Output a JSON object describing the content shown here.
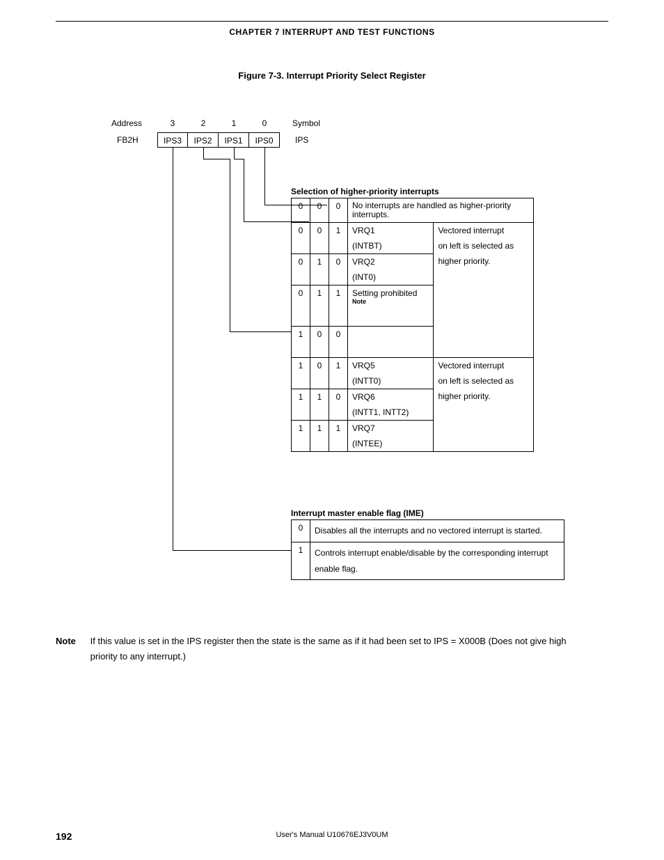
{
  "header": {
    "chapter": "CHAPTER 7   INTERRUPT AND TEST FUNCTIONS"
  },
  "figure": {
    "title": "Figure 7-3.  Interrupt Priority Select Register"
  },
  "register": {
    "address_label": "Address",
    "symbol_label": "Symbol",
    "address_value": "FB2H",
    "symbol_value": "IPS",
    "bit_numbers": [
      "3",
      "2",
      "1",
      "0"
    ],
    "bit_names": [
      "IPS3",
      "IPS2",
      "IPS1",
      "IPS0"
    ]
  },
  "table1": {
    "title": "Selection of higher-priority interrupts",
    "rows": [
      {
        "b": [
          "0",
          "0",
          "0"
        ],
        "desc1": "No interrupts are handled as higher-priority interrupts.",
        "desc2": "",
        "vec": ""
      },
      {
        "b": [
          "0",
          "0",
          "1"
        ],
        "desc1": "VRQ1",
        "desc2": "(INTBT)",
        "vec": "Vectored interrupt"
      },
      {
        "b": [
          "0",
          "1",
          "0"
        ],
        "desc1": "VRQ2",
        "desc2": "(INT0)",
        "vec": "on left is selected as"
      },
      {
        "b": [
          "0",
          "1",
          "1"
        ],
        "desc1": "Setting prohibited",
        "desc2": "",
        "vec": "higher priority.",
        "noteSup": "Note"
      },
      {
        "b": [
          "1",
          "0",
          "0"
        ],
        "desc1": "",
        "desc2": "",
        "vec": ""
      },
      {
        "b": [
          "1",
          "0",
          "1"
        ],
        "desc1": "VRQ5",
        "desc2": "(INTT0)",
        "vec": "Vectored interrupt"
      },
      {
        "b": [
          "1",
          "1",
          "0"
        ],
        "desc1": "VRQ6",
        "desc2": "(INTT1, INTT2)",
        "vec": "on left is selected as"
      },
      {
        "b": [
          "1",
          "1",
          "1"
        ],
        "desc1": "VRQ7",
        "desc2": "(INTEE)",
        "vec": "higher priority."
      }
    ],
    "vec_group1": [
      "Vectored interrupt",
      "on left is selected as",
      "higher priority."
    ],
    "vec_group2": [
      "Vectored interrupt",
      "on left is selected as",
      "higher priority."
    ]
  },
  "table2": {
    "title": "Interrupt master enable flag (IME)",
    "rows": [
      {
        "b": "0",
        "desc": "Disables all the interrupts and no vectored interrupt is started."
      },
      {
        "b": "1",
        "desc": "Controls interrupt enable/disable by the corresponding interrupt enable flag."
      }
    ]
  },
  "note": {
    "label": "Note",
    "text": "If this value is set in the IPS register then the state is the same as if it had been set to IPS = X000B (Does not give high priority to any interrupt.)"
  },
  "footer": {
    "page_number": "192",
    "text": "User's Manual  U10676EJ3V0UM"
  }
}
